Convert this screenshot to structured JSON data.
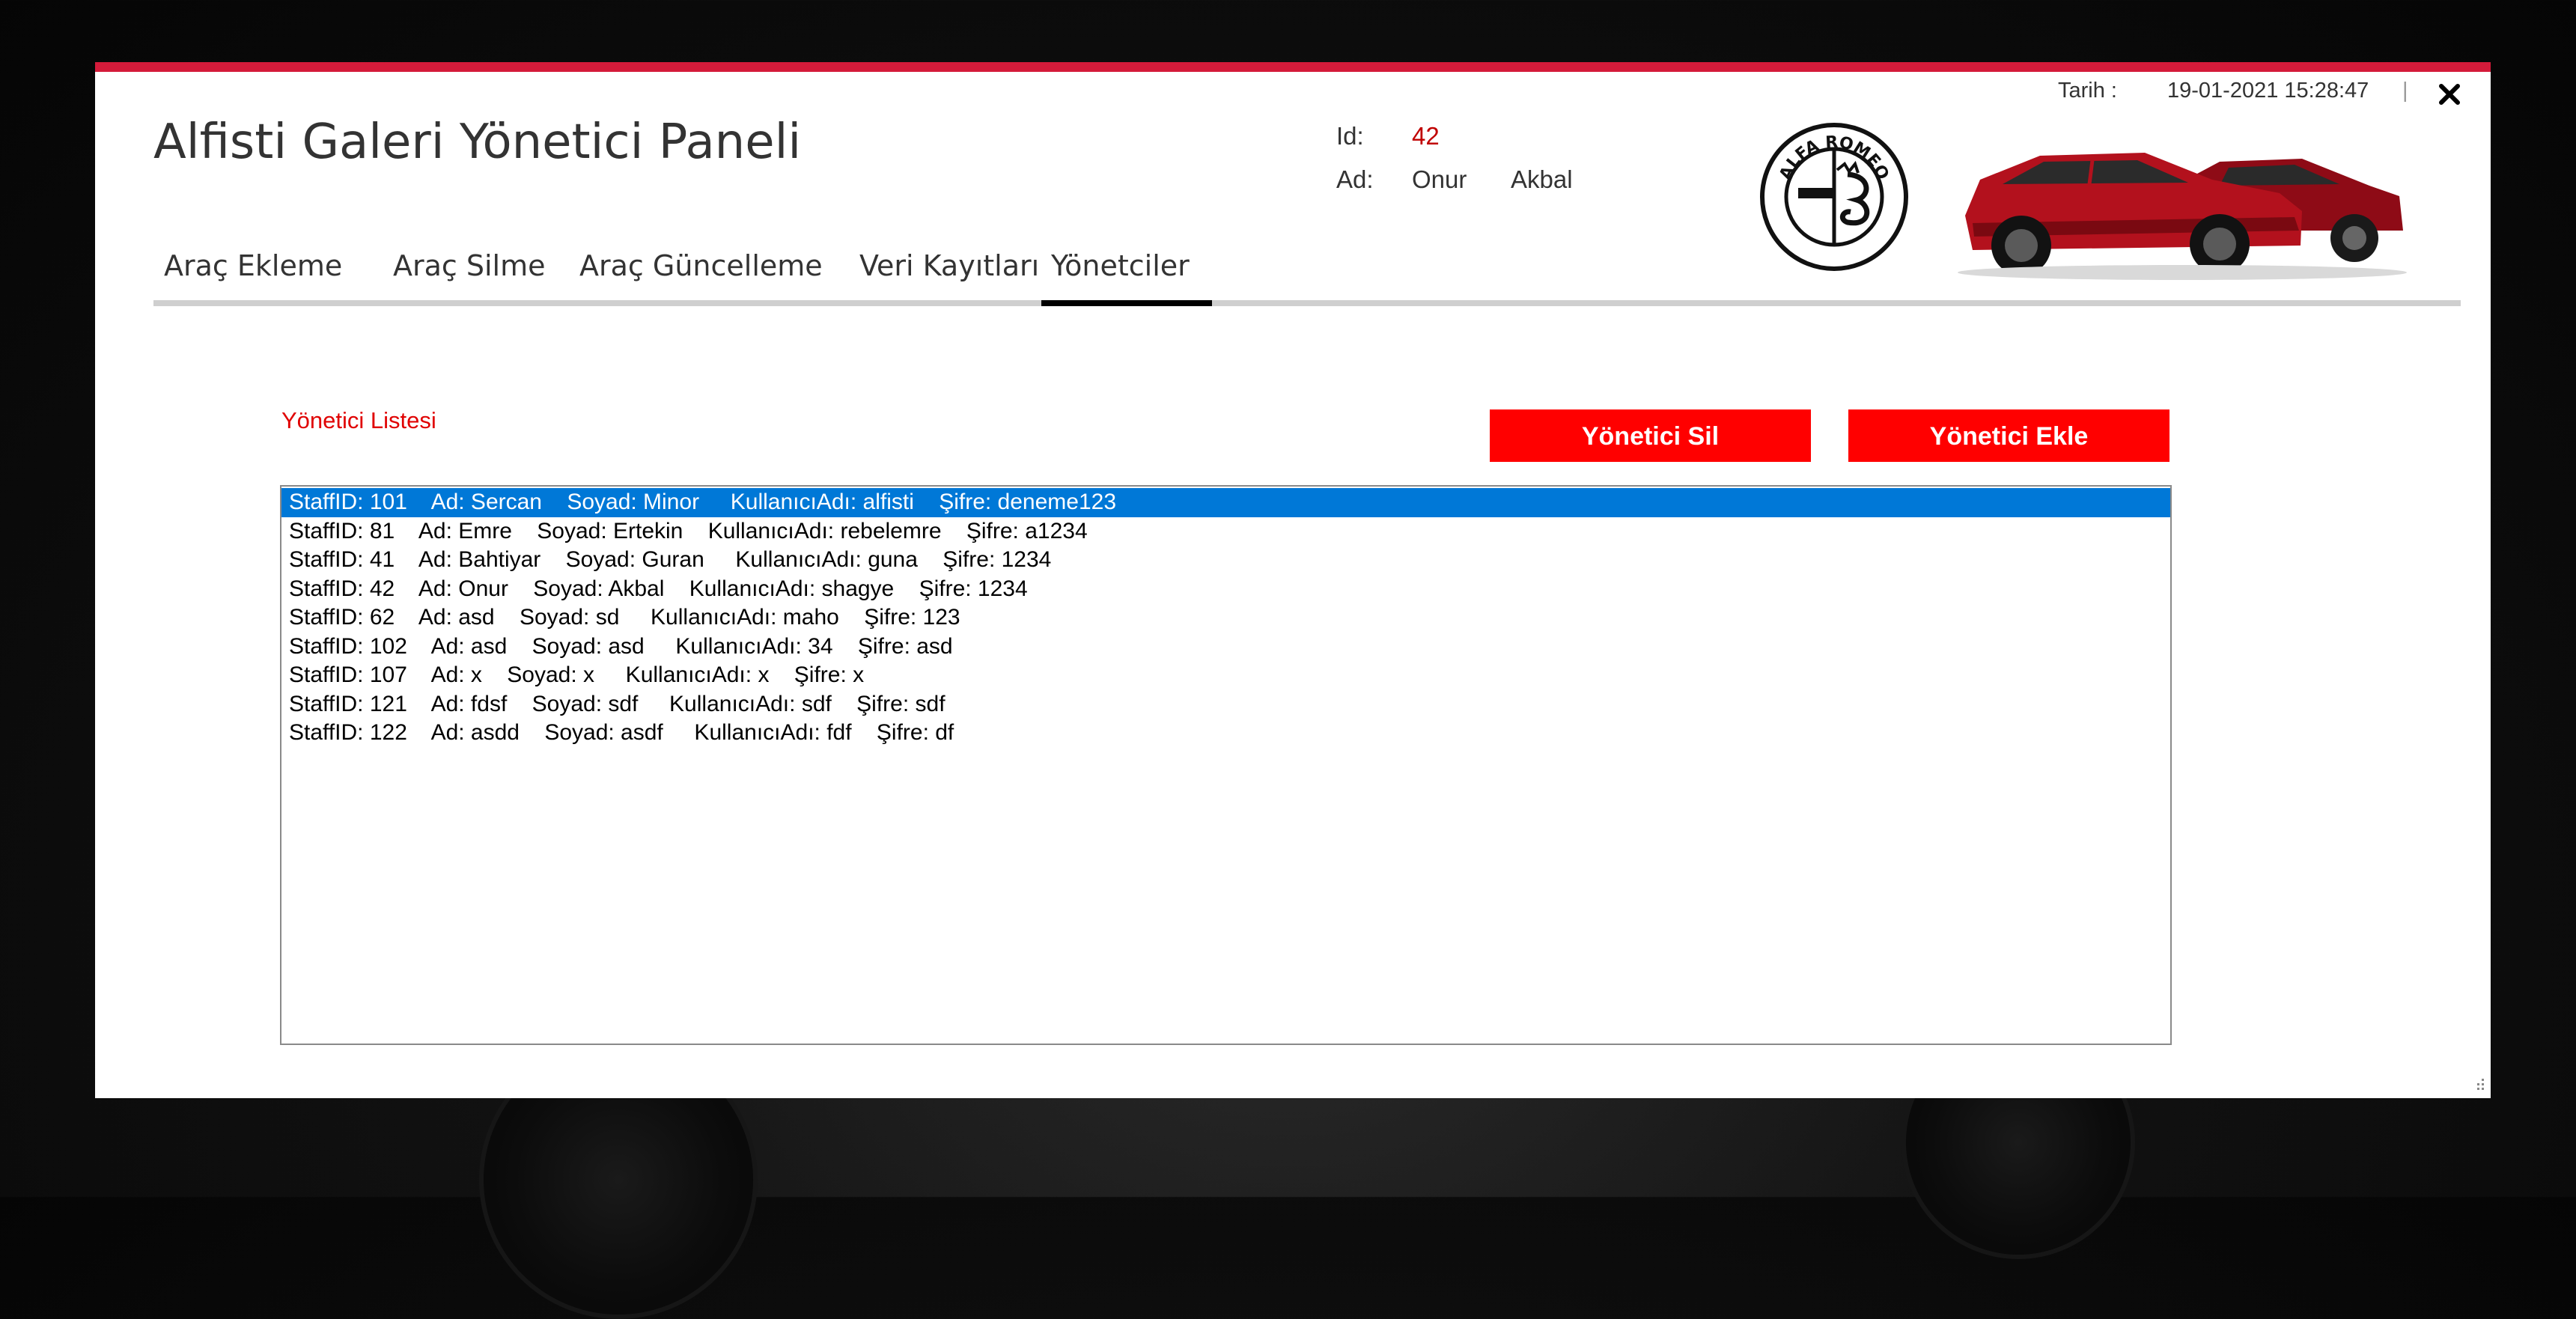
{
  "app": {
    "title": "Alfisti Galeri Yönetici Paneli"
  },
  "tabs": [
    {
      "label": "Araç Ekleme",
      "active": false
    },
    {
      "label": "Araç Silme",
      "active": false
    },
    {
      "label": "Araç Güncelleme",
      "active": false
    },
    {
      "label": "Veri Kayıtları",
      "active": false
    },
    {
      "label": "Yönetciler",
      "active": true
    }
  ],
  "user": {
    "id_label": "Id:",
    "id_value": "42",
    "name_label": "Ad:",
    "first_name": "Onur",
    "last_name": "Akbal"
  },
  "header": {
    "date_label": "Tarih :",
    "date_value": "19-01-2021 15:28:47",
    "separator": "|"
  },
  "logo": {
    "brand": "ALFA ROMEO",
    "icon": "alfa-romeo-logo"
  },
  "admins": {
    "section_label": "Yönetici Listesi",
    "delete_button": "Yönetici Sil",
    "add_button": "Yönetici Ekle",
    "rows": [
      {
        "text": "StaffID: 101    Ad: Sercan    Soyad: Minor     KullanıcıAdı: alfisti    Şifre: deneme123",
        "selected": true
      },
      {
        "text": "StaffID: 81    Ad: Emre    Soyad: Ertekin    KullanıcıAdı: rebelemre    Şifre: a1234",
        "selected": false
      },
      {
        "text": "StaffID: 41    Ad: Bahtiyar    Soyad: Guran     KullanıcıAdı: guna    Şifre: 1234",
        "selected": false
      },
      {
        "text": "StaffID: 42    Ad: Onur    Soyad: Akbal    KullanıcıAdı: shagye    Şifre: 1234",
        "selected": false
      },
      {
        "text": "StaffID: 62    Ad: asd    Soyad: sd     KullanıcıAdı: maho    Şifre: 123",
        "selected": false
      },
      {
        "text": "StaffID: 102    Ad: asd    Soyad: asd     KullanıcıAdı: 34    Şifre: asd",
        "selected": false
      },
      {
        "text": "StaffID: 107    Ad: x    Soyad: x     KullanıcıAdı: x    Şifre: x",
        "selected": false
      },
      {
        "text": "StaffID: 121    Ad: fdsf    Soyad: sdf     KullanıcıAdı: sdf    Şifre: sdf",
        "selected": false
      },
      {
        "text": "StaffID: 122    Ad: asdd    Soyad: asdf     KullanıcıAdı: fdf    Şifre: df",
        "selected": false
      }
    ]
  },
  "colors": {
    "accent_stripe": "#d41b3a",
    "button_red": "#ff0000",
    "label_red": "#e00000",
    "id_value_red": "#c00000",
    "selection_blue": "#0078d7",
    "car_red": "#b3111d"
  }
}
